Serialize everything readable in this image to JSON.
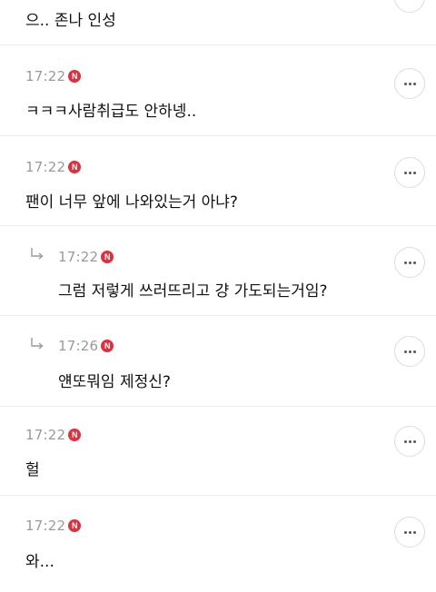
{
  "comments": [
    {
      "time": "",
      "text": "으.. 존나 인성",
      "reply": false
    },
    {
      "time": "17:22",
      "text": "ㅋㅋㅋ사람취급도 안하넹..",
      "reply": false
    },
    {
      "time": "17:22",
      "text": "팬이 너무 앞에 나와있는거 아냐?",
      "reply": false
    },
    {
      "time": "17:22",
      "text": "그럼 저렇게 쓰러뜨리고 걍 가도되는거임?",
      "reply": true
    },
    {
      "time": "17:26",
      "text": "얜또뭐임 제정신?",
      "reply": true
    },
    {
      "time": "17:22",
      "text": "헐",
      "reply": false
    },
    {
      "time": "17:22",
      "text": "와...",
      "reply": false
    }
  ],
  "badge_letter": "N",
  "icons": {
    "more": "more-options-icon",
    "reply": "reply-arrow-icon",
    "badge": "naver-n-badge-icon"
  },
  "colors": {
    "badge": "#e0303e",
    "time": "#9a9a9a",
    "divider": "#ececec"
  }
}
